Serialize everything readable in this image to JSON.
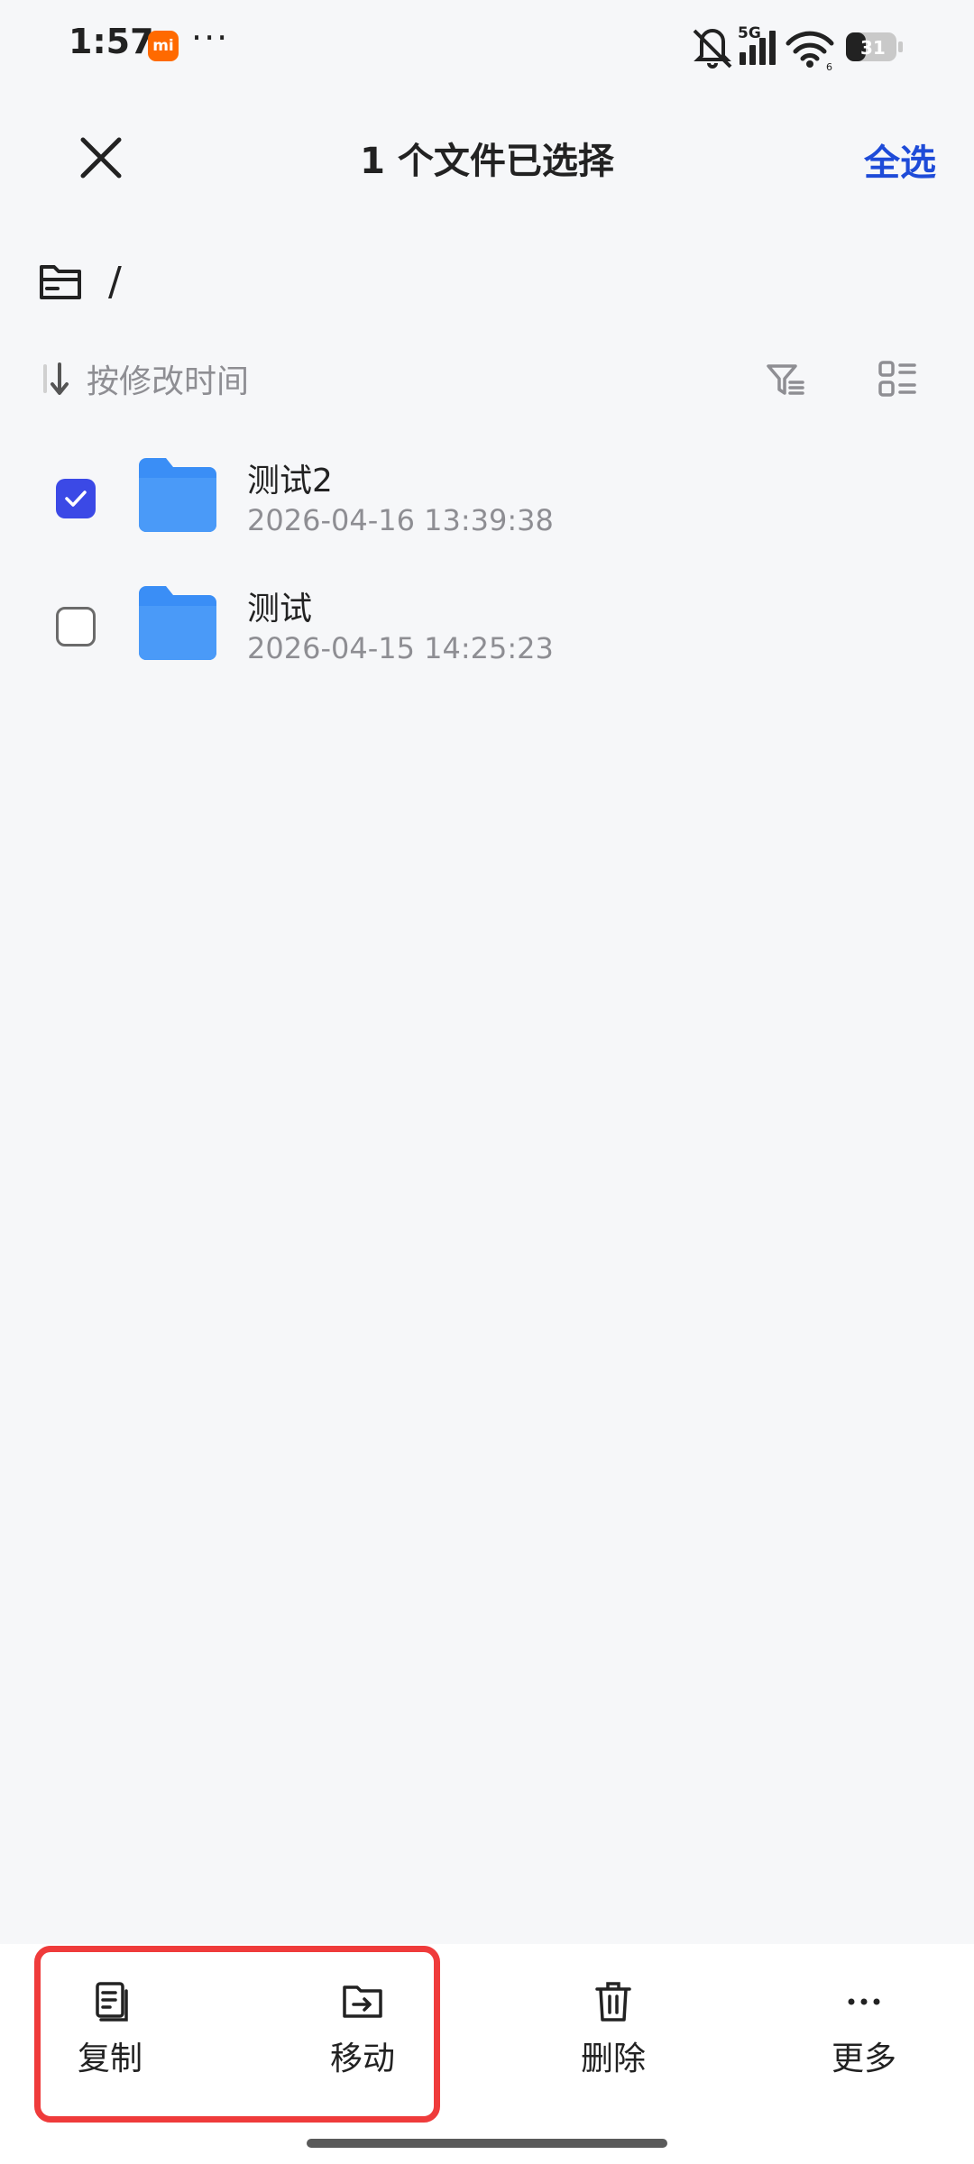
{
  "status_bar": {
    "time": "1:57",
    "carrier_badge": "mi",
    "more": "···",
    "network": "5G",
    "battery": "31"
  },
  "header": {
    "title": "1 个文件已选择",
    "select_all": "全选"
  },
  "path": {
    "text": "/"
  },
  "sort": {
    "label": "按修改时间"
  },
  "files": [
    {
      "name": "测试2",
      "date": "2026-04-16 13:39:38",
      "checked": true
    },
    {
      "name": "测试",
      "date": "2026-04-15 14:25:23",
      "checked": false
    }
  ],
  "actions": {
    "copy": "复制",
    "move": "移动",
    "delete": "删除",
    "more": "更多"
  },
  "colors": {
    "accent": "#1e4bd8",
    "checkbox": "#3b49e6",
    "folder": "#3a8ef6",
    "highlight": "#ef3b3b"
  }
}
